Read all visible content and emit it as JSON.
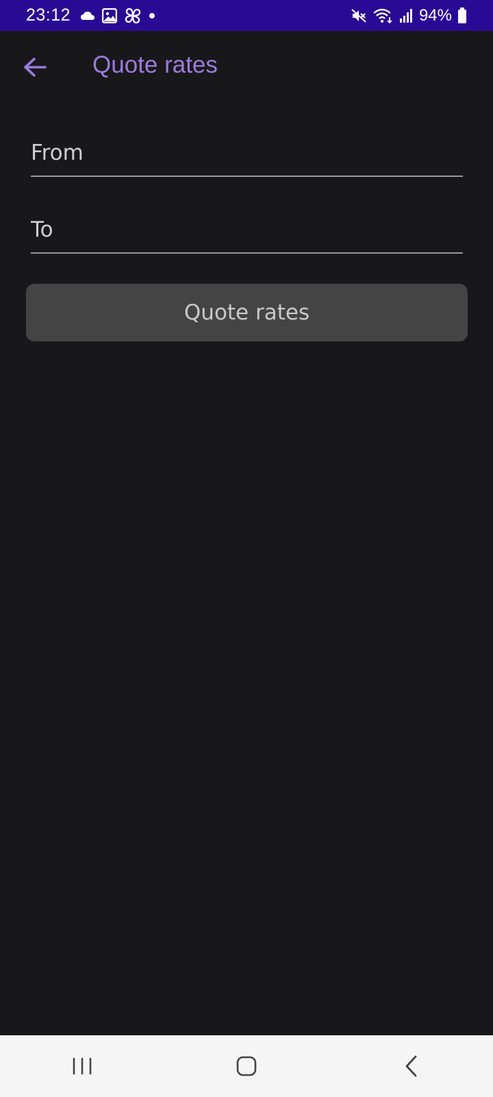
{
  "status_bar": {
    "time": "23:12",
    "left_icons": [
      "cloud-icon",
      "gallery-icon",
      "pinwheel-icon",
      "dot-icon"
    ],
    "right_icons": [
      "mute-icon",
      "wifi-icon",
      "signal-icon",
      "battery-icon"
    ],
    "battery_percent": "94%",
    "background_color": "#290a95"
  },
  "app_bar": {
    "title": "Quote rates",
    "accent_color": "#9b7bdc"
  },
  "form": {
    "from_placeholder": "From",
    "from_value": "",
    "to_placeholder": "To",
    "to_value": "",
    "submit_label": "Quote rates"
  },
  "nav_bar": {
    "buttons": [
      "recent-apps-icon",
      "home-icon",
      "back-icon"
    ]
  }
}
